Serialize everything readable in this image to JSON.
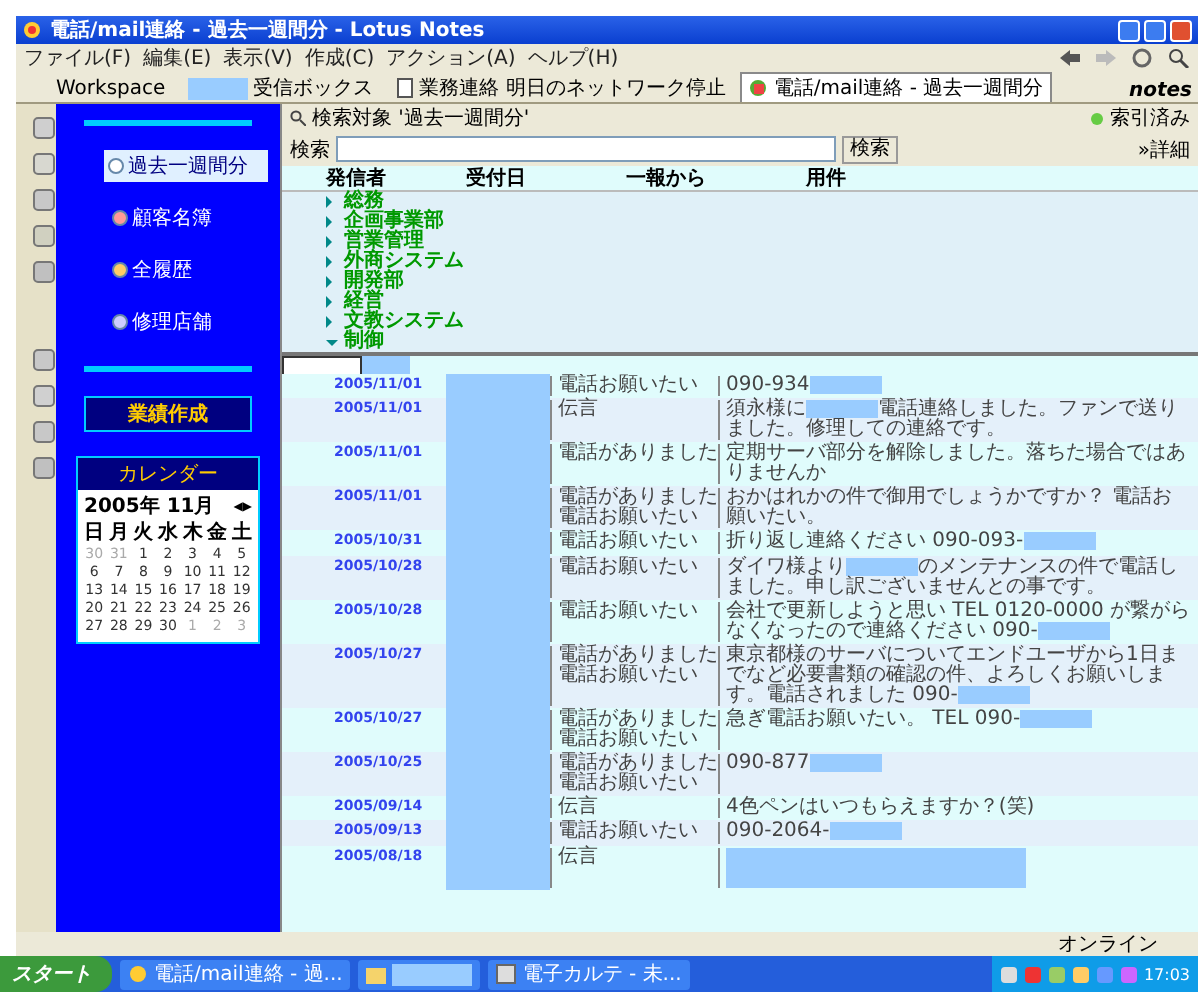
{
  "window": {
    "title": "電話/mail連絡 - 過去一週間分 - Lotus Notes"
  },
  "menu": [
    "ファイル(F)",
    "編集(E)",
    "表示(V)",
    "作成(C)",
    "アクション(A)",
    "ヘルプ(H)"
  ],
  "tabs": [
    {
      "label": "Workspace",
      "selected": false,
      "kind": "plain"
    },
    {
      "label": "受信ボックス",
      "selected": false,
      "kind": "redacted"
    },
    {
      "label": "業務連絡 明日のネットワーク停止",
      "selected": false,
      "kind": "doc"
    },
    {
      "label": "電話/mail連絡 - 過去一週間分",
      "selected": true,
      "kind": "db"
    }
  ],
  "brand": "notes",
  "nav": {
    "items": [
      {
        "label": "過去一週間分",
        "selected": true,
        "color": "#ffffff"
      },
      {
        "label": "顧客名簿",
        "selected": false,
        "color": "#ff9999"
      },
      {
        "label": "全履歴",
        "selected": false,
        "color": "#ffcc66"
      },
      {
        "label": "修理店舗",
        "selected": false,
        "color": "#ccccff"
      }
    ],
    "section": "業績作成",
    "calendar": {
      "title": "カレンダー",
      "month": "2005年 11月",
      "arrows": "◀▶",
      "weekdays": [
        "日",
        "月",
        "火",
        "水",
        "木",
        "金",
        "土"
      ],
      "days": [
        {
          "label": "30",
          "current": false
        },
        {
          "label": "31",
          "current": false
        },
        {
          "label": "1",
          "current": true
        },
        {
          "label": "2",
          "current": true
        },
        {
          "label": "3",
          "current": true
        },
        {
          "label": "4",
          "current": true
        },
        {
          "label": "5",
          "current": true
        },
        {
          "label": "6",
          "current": true
        },
        {
          "label": "7",
          "current": true
        },
        {
          "label": "8",
          "current": true
        },
        {
          "label": "9",
          "current": true
        },
        {
          "label": "10",
          "current": true
        },
        {
          "label": "11",
          "current": true
        },
        {
          "label": "12",
          "current": true
        },
        {
          "label": "13",
          "current": true
        },
        {
          "label": "14",
          "current": true
        },
        {
          "label": "15",
          "current": true
        },
        {
          "label": "16",
          "current": true
        },
        {
          "label": "17",
          "current": true
        },
        {
          "label": "18",
          "current": true
        },
        {
          "label": "19",
          "current": true
        },
        {
          "label": "20",
          "current": true
        },
        {
          "label": "21",
          "current": true
        },
        {
          "label": "22",
          "current": true
        },
        {
          "label": "23",
          "current": true
        },
        {
          "label": "24",
          "current": true
        },
        {
          "label": "25",
          "current": true
        },
        {
          "label": "26",
          "current": true
        },
        {
          "label": "27",
          "current": true
        },
        {
          "label": "28",
          "current": true
        },
        {
          "label": "29",
          "current": true
        },
        {
          "label": "30",
          "current": true
        },
        {
          "label": "1",
          "current": false
        },
        {
          "label": "2",
          "current": false
        },
        {
          "label": "3",
          "current": false
        }
      ]
    }
  },
  "search": {
    "scope": "検索対象 '過去一週間分'",
    "status": "索引済み",
    "label": "検索",
    "button": "検索",
    "detail": "»詳細"
  },
  "columns": [
    "発信者",
    "受付日",
    "一報から",
    "用件"
  ],
  "categories": [
    {
      "label": "総務",
      "expanded": false
    },
    {
      "label": "企画事業部",
      "expanded": false
    },
    {
      "label": "営業管理",
      "expanded": false
    },
    {
      "label": "外商システム",
      "expanded": false
    },
    {
      "label": "開発部",
      "expanded": false
    },
    {
      "label": "経営",
      "expanded": false
    },
    {
      "label": "文教システム",
      "expanded": false
    },
    {
      "label": "制御",
      "expanded": true
    }
  ],
  "rows": [
    {
      "date": "2005/11/01",
      "caller": "電話お願いたい",
      "subject": [
        {
          "kind": "text",
          "text": "090-934"
        },
        {
          "kind": "redacted"
        }
      ]
    },
    {
      "date": "2005/11/01",
      "caller": "伝言",
      "subject": [
        {
          "kind": "text",
          "text": "須永様に"
        },
        {
          "kind": "redacted"
        },
        {
          "kind": "text",
          "text": "電話連絡しました。ファンで送りました。修理しての連絡です。"
        }
      ]
    },
    {
      "date": "2005/11/01",
      "caller": "電話がありました",
      "subject": [
        {
          "kind": "text",
          "text": "定期サーバ部分を解除しました。落ちた場合ではありませんか"
        }
      ]
    },
    {
      "date": "2005/11/01",
      "caller": "電話がありました電話お願いたい",
      "subject": [
        {
          "kind": "text",
          "text": "おかはれかの件で御用でしょうかですか？ 電話お願いたい。"
        }
      ]
    },
    {
      "date": "2005/10/31",
      "caller": "電話お願いたい",
      "subject": [
        {
          "kind": "text",
          "text": "折り返し連絡ください 090-093-"
        },
        {
          "kind": "redacted"
        }
      ]
    },
    {
      "date": "2005/10/28",
      "caller": "電話お願いたい",
      "subject": [
        {
          "kind": "text",
          "text": "ダイワ様より"
        },
        {
          "kind": "redacted"
        },
        {
          "kind": "text",
          "text": "のメンテナンスの件で電話しました。申し訳ございませんとの事です。"
        }
      ]
    },
    {
      "date": "2005/10/28",
      "caller": "電話お願いたい",
      "subject": [
        {
          "kind": "text",
          "text": "会社で更新しようと思い TEL 0120-0000 が繋がらなくなったので連絡ください 090-"
        },
        {
          "kind": "redacted"
        }
      ]
    },
    {
      "date": "2005/10/27",
      "caller": "電話がありました電話お願いたい",
      "subject": [
        {
          "kind": "text",
          "text": "東京都様のサーバについてエンドユーザから1日までなど必要書類の確認の件、よろしくお願いします。電話されました 090-"
        },
        {
          "kind": "redacted"
        }
      ]
    },
    {
      "date": "2005/10/27",
      "caller": "電話がありました電話お願いたい",
      "subject": [
        {
          "kind": "text",
          "text": "急ぎ電話お願いたい。 TEL 090-"
        },
        {
          "kind": "redacted"
        }
      ]
    },
    {
      "date": "2005/10/25",
      "caller": "電話がありました電話お願いたい",
      "subject": [
        {
          "kind": "text",
          "text": "090-877"
        },
        {
          "kind": "redacted"
        }
      ]
    },
    {
      "date": "2005/09/14",
      "caller": "伝言",
      "subject": [
        {
          "kind": "text",
          "text": "4色ペンはいつもらえますか？(笑)"
        }
      ]
    },
    {
      "date": "2005/09/13",
      "caller": "電話お願いたい",
      "subject": [
        {
          "kind": "text",
          "text": "090-2064-"
        },
        {
          "kind": "redacted"
        }
      ]
    },
    {
      "date": "2005/08/18",
      "caller": "伝言",
      "subject": [
        {
          "kind": "redacted"
        }
      ]
    }
  ],
  "status_bar": "オンライン",
  "taskbar": {
    "start": "スタート",
    "items": [
      {
        "label": "電話/mail連絡 - 過...",
        "kind": "notes"
      },
      {
        "kind": "folder"
      },
      {
        "label": "電子カルテ - 未...",
        "kind": "app"
      }
    ],
    "clock": "17:03"
  }
}
